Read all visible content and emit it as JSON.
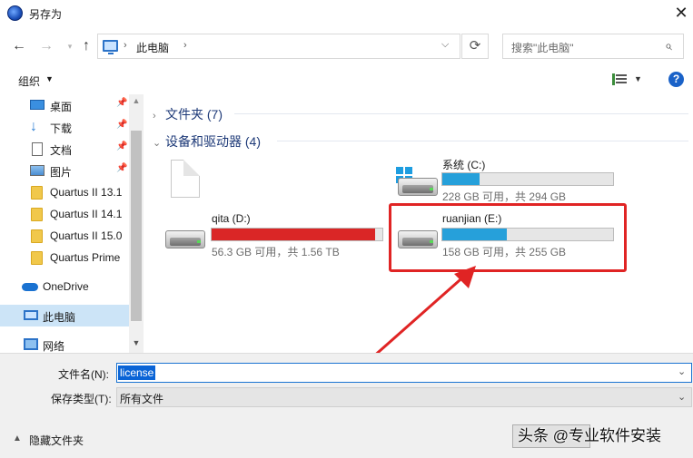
{
  "window": {
    "title": "另存为",
    "close_glyph": "✕"
  },
  "nav": {
    "address_path": "此电脑",
    "search_placeholder": "搜索\"此电脑\""
  },
  "toolbar": {
    "organize_label": "组织"
  },
  "sidebar": {
    "items": [
      {
        "label": "桌面",
        "pinned": true
      },
      {
        "label": "下载",
        "pinned": true
      },
      {
        "label": "文档",
        "pinned": true
      },
      {
        "label": "图片",
        "pinned": true
      },
      {
        "label": "Quartus II 13.1"
      },
      {
        "label": "Quartus II 14.1"
      },
      {
        "label": "Quartus II 15.0"
      },
      {
        "label": "Quartus Prime"
      },
      {
        "label": "OneDrive"
      },
      {
        "label": "此电脑",
        "selected": true
      },
      {
        "label": "网络"
      }
    ]
  },
  "main": {
    "groups": [
      {
        "label": "文件夹 (7)",
        "expanded": false
      },
      {
        "label": "设备和驱动器 (4)",
        "expanded": true
      }
    ],
    "drives": [
      {
        "name": "系统 (C:)",
        "info": "228 GB 可用，共 294 GB",
        "used_fraction": 0.22,
        "color": "#26a0da"
      },
      {
        "name": "qita (D:)",
        "info": "56.3 GB 可用，共 1.56 TB",
        "used_fraction": 0.96,
        "color": "#da2626"
      },
      {
        "name": "ruanjian (E:)",
        "info": "158 GB 可用，共 255 GB",
        "used_fraction": 0.38,
        "color": "#26a0da"
      }
    ]
  },
  "form": {
    "filename_label": "文件名(N):",
    "filename_value": "license",
    "filetype_label": "保存类型(T):",
    "filetype_value": "所有文件",
    "hide_folders_label": "隐藏文件夹"
  },
  "watermark": "头条 @专业软件安装",
  "colors": {
    "accent": "#0a64d6",
    "highlight": "#e02424",
    "drive_ok": "#26a0da",
    "drive_full": "#da2626"
  }
}
